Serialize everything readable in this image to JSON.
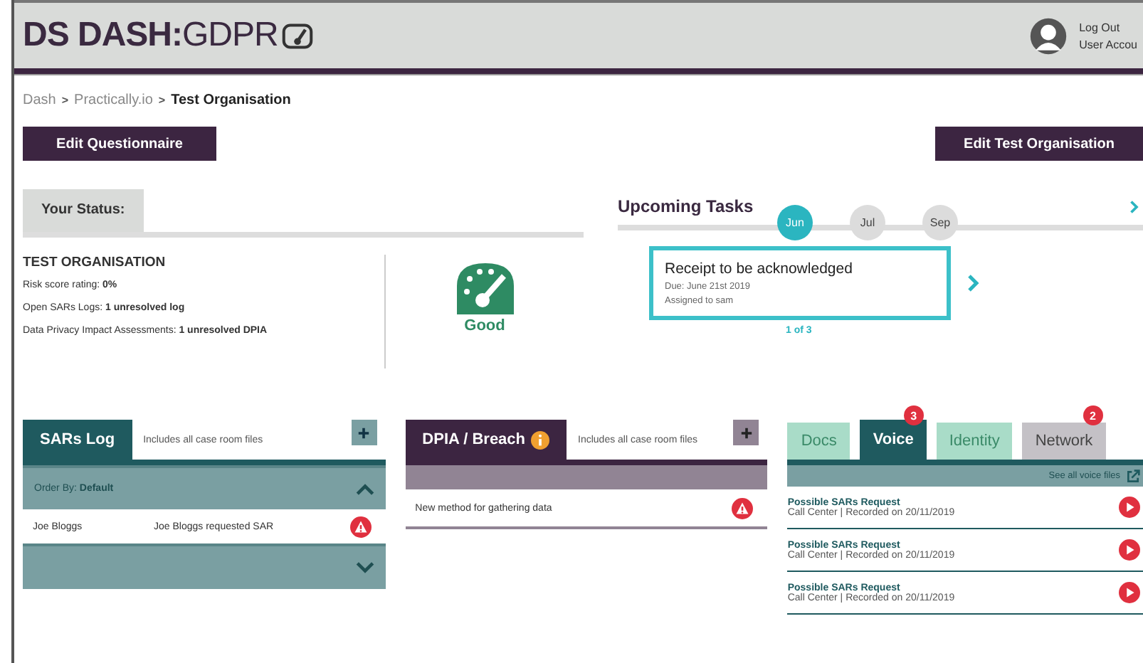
{
  "header": {
    "logo_bold": "DS DASH:",
    "logo_light": "GDPR",
    "user_links": [
      "Log Out",
      "User Accou"
    ]
  },
  "breadcrumb": {
    "separator": ">",
    "items": [
      {
        "label": "Dash",
        "current": false
      },
      {
        "label": "Practically.io",
        "current": false
      },
      {
        "label": "Test Organisation",
        "current": true
      }
    ]
  },
  "actions": [
    "Edit Questionnaire",
    "Edit Test Organisation"
  ],
  "status": {
    "tab": "Your Status:",
    "org": "TEST ORGANISATION",
    "facts": [
      {
        "label": "Risk score rating:",
        "value": "0%"
      },
      {
        "label": "Open SARs Logs:",
        "value": "1 unresolved log"
      },
      {
        "label": "Data Privacy Impact Assessments:",
        "value": "1 unresolved DPIA"
      }
    ],
    "rating": "Good"
  },
  "tasks": {
    "title": "Upcoming Tasks",
    "months": [
      {
        "label": "Jun",
        "selected": true
      },
      {
        "label": "Jul",
        "selected": false
      },
      {
        "label": "Sep",
        "selected": false
      }
    ],
    "card": {
      "title": "Receipt to be acknowledged",
      "due": "Due: June 21st 2019",
      "assigned": "Assigned to sam"
    },
    "pager": "1 of 3"
  },
  "sars": {
    "title": "SARs Log",
    "note": "Includes all case room files",
    "order_label": "Order By:",
    "order_value": "Default",
    "rows": [
      {
        "name": "Joe Bloggs",
        "text": "Joe Bloggs requested SAR"
      }
    ]
  },
  "dpia": {
    "title": "DPIA / Breach",
    "note": "Includes all case room files",
    "rows": [
      {
        "text": "New method for gathering data"
      }
    ]
  },
  "media": {
    "tabs": [
      {
        "label": "Docs",
        "selected": false,
        "color": "#a9dcc8"
      },
      {
        "label": "Voice",
        "selected": true,
        "color": "#1f5a5f",
        "badge": "3"
      },
      {
        "label": "Identity",
        "selected": false,
        "color": "#a9dcc8"
      },
      {
        "label": "Network",
        "selected": false,
        "color": "#c4c1c6",
        "badge": "2"
      }
    ],
    "link": "See all voice files",
    "items": [
      {
        "title": "Possible SARs Request",
        "meta": "Call Center | Recorded on 20/11/2019"
      },
      {
        "title": "Possible SARs Request",
        "meta": "Call Center | Recorded on 20/11/2019"
      },
      {
        "title": "Possible SARs Request",
        "meta": "Call Center | Recorded on 20/11/2019"
      }
    ]
  }
}
